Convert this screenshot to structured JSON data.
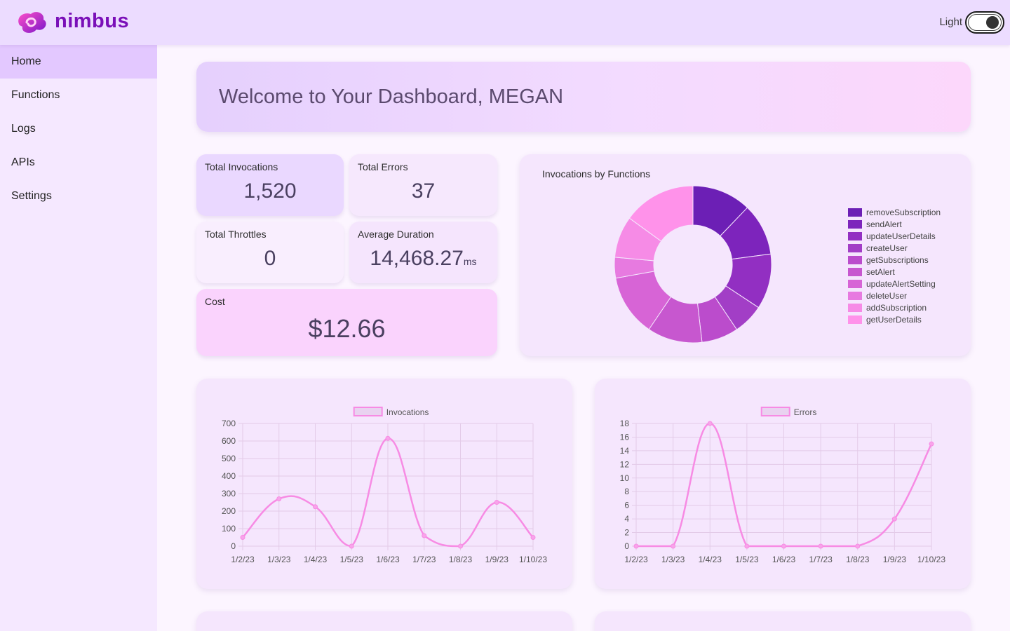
{
  "app": {
    "brand": "nimbus",
    "theme_label": "Light",
    "brand_color": "#7a0fb8",
    "logo_icon": "nimbus-swirl-logo"
  },
  "sidebar": {
    "items": [
      {
        "label": "Home",
        "active": true
      },
      {
        "label": "Functions",
        "active": false
      },
      {
        "label": "Logs",
        "active": false
      },
      {
        "label": "APIs",
        "active": false
      },
      {
        "label": "Settings",
        "active": false
      }
    ]
  },
  "welcome": {
    "title": "Welcome to Your Dashboard, MEGAN"
  },
  "stats": {
    "invocations": {
      "label": "Total Invocations",
      "value": "1,520"
    },
    "errors": {
      "label": "Total Errors",
      "value": "37"
    },
    "throttles": {
      "label": "Total Throttles",
      "value": "0"
    },
    "duration": {
      "label": "Average Duration",
      "value": "14,468.27",
      "unit": "ms"
    },
    "cost": {
      "label": "Cost",
      "value": "$12.66"
    }
  },
  "colors": {
    "line": "#f78be4",
    "grid": "#e3cbe8",
    "stat_tiles": [
      "#ead8ff",
      "#f6e8fd",
      "#f9eefe",
      "#f5e5fd",
      "#fad3fd"
    ]
  },
  "chart_data": [
    {
      "type": "pie",
      "title": "Invocations by Functions",
      "variant": "doughnut",
      "legend_position": "right",
      "categories": [
        "removeSubscription",
        "sendAlert",
        "updateUserDetails",
        "createUser",
        "getSubscriptions",
        "setAlert",
        "updateAlertSetting",
        "deleteUser",
        "addSubscription",
        "getUserDetails"
      ],
      "values": [
        185,
        163,
        173,
        96,
        115,
        172,
        193,
        65,
        130,
        228
      ],
      "colors": [
        "#6c1fb5",
        "#7d24bc",
        "#922fc2",
        "#a23ec6",
        "#bb4ccc",
        "#c757cf",
        "#d764d6",
        "#e77ae0",
        "#f68be6",
        "#ff92ea"
      ]
    },
    {
      "type": "line",
      "series": [
        {
          "name": "Invocations",
          "values": [
            50,
            270,
            225,
            0,
            615,
            60,
            0,
            250,
            50
          ]
        }
      ],
      "x": [
        "1/2/23",
        "1/3/23",
        "1/4/23",
        "1/5/23",
        "1/6/23",
        "1/7/23",
        "1/8/23",
        "1/9/23",
        "1/10/23"
      ],
      "ylim": [
        0,
        700
      ],
      "yticks": [
        0,
        100,
        200,
        300,
        400,
        500,
        600,
        700
      ],
      "legend_position": "top",
      "grid": true
    },
    {
      "type": "line",
      "series": [
        {
          "name": "Errors",
          "values": [
            0,
            0,
            18,
            0,
            0,
            0,
            0,
            4,
            15
          ]
        }
      ],
      "x": [
        "1/2/23",
        "1/3/23",
        "1/4/23",
        "1/5/23",
        "1/6/23",
        "1/7/23",
        "1/8/23",
        "1/9/23",
        "1/10/23"
      ],
      "ylim": [
        0,
        18
      ],
      "yticks": [
        0,
        2,
        4,
        6,
        8,
        10,
        12,
        14,
        16,
        18
      ],
      "legend_position": "top",
      "grid": true
    }
  ]
}
